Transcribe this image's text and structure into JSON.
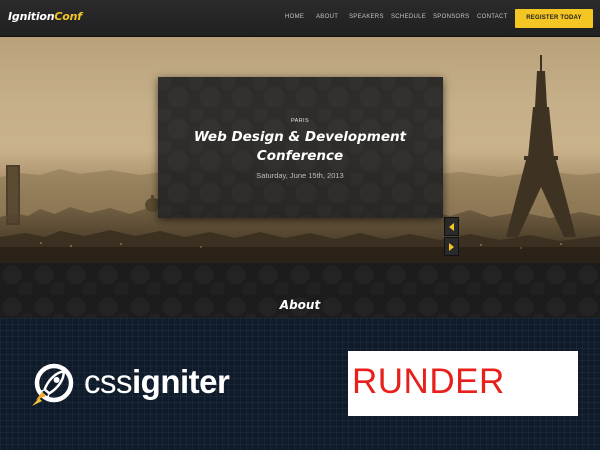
{
  "header": {
    "logo_part1": "Ignition",
    "logo_part2": "Conf",
    "nav": [
      "HOME",
      "ABOUT",
      "SPEAKERS",
      "SCHEDULE",
      "SPONSORS",
      "CONTACT"
    ],
    "register_label": "REGISTER TODAY"
  },
  "hero": {
    "city": "PARIS",
    "title_line1": "Web Design & Development",
    "title_line2": "Conference",
    "date": "Saturday, June 15th, 2013",
    "prev_icon": "arrow-left-icon",
    "next_icon": "arrow-right-icon"
  },
  "about": {
    "title": "About"
  },
  "footer": {
    "brand_part1": "css",
    "brand_part2": "igniter",
    "brand_icon": "rocket-icon",
    "badge_text": "RUNDER"
  },
  "colors": {
    "accent": "#f3c623",
    "nav_bg": "#242424",
    "footer_bg": "#0f1b2a",
    "badge_red": "#e8201c"
  }
}
